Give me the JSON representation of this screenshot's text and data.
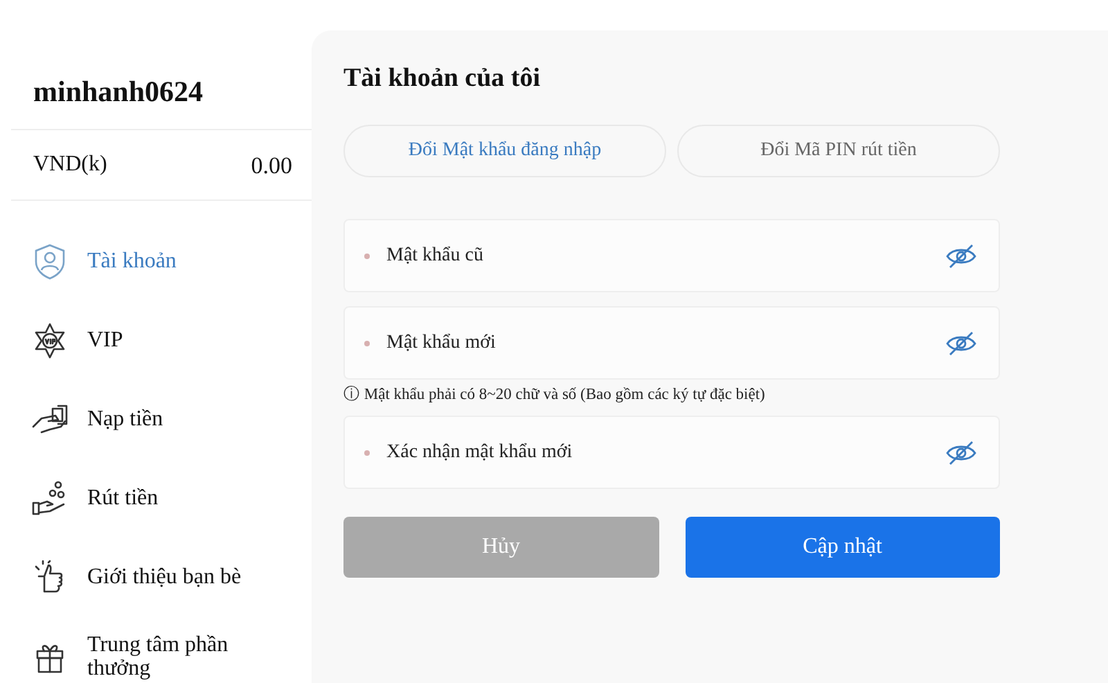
{
  "sidebar": {
    "username": "minhanh0624",
    "balance": {
      "currency": "VND(k)",
      "amount": "0.00"
    },
    "items": [
      {
        "label": "Tài khoản",
        "selected": true
      },
      {
        "label": "VIP",
        "selected": false
      },
      {
        "label": "Nạp tiền",
        "selected": false
      },
      {
        "label": "Rút tiền",
        "selected": false
      },
      {
        "label": "Giới thiệu bạn bè",
        "selected": false
      },
      {
        "label": "Trung tâm phần thưởng",
        "selected": false
      }
    ]
  },
  "panel": {
    "title": "Tài khoản của tôi",
    "tabs": [
      {
        "label": "Đổi Mật khẩu đăng nhập",
        "selected": true
      },
      {
        "label": "Đổi Mã PIN rút tiền",
        "selected": false
      }
    ],
    "fields": [
      {
        "placeholder": "Mật khẩu cũ",
        "required": true
      },
      {
        "placeholder": "Mật khẩu mới",
        "required": true,
        "hint": "ⓘ Mật khẩu phải có 8~20 chữ và số (Bao gồm các ký tự đặc biệt)"
      },
      {
        "placeholder": "Xác nhận mật khẩu mới",
        "required": true
      }
    ],
    "buttons": [
      {
        "label": "Hủy",
        "kind": "cancel"
      },
      {
        "label": "Cập nhật",
        "kind": "primary"
      }
    ]
  }
}
